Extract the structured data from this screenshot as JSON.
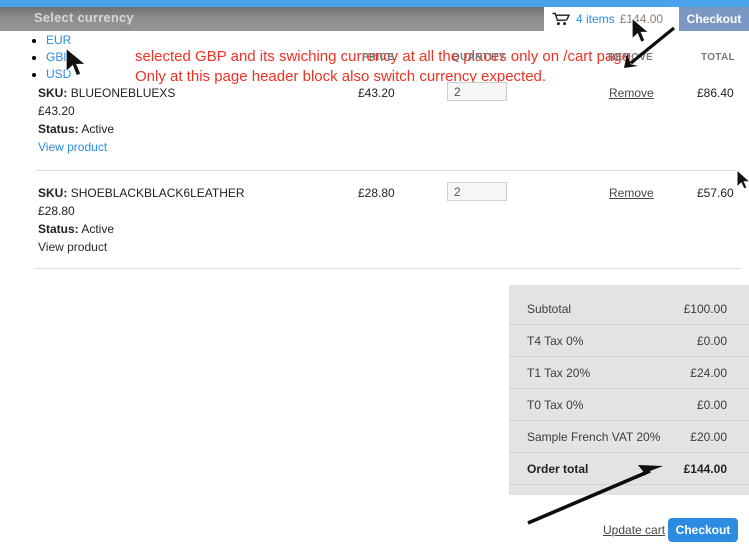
{
  "header": {
    "admin_title": "Select currency",
    "cart_icon": "shopping-cart-icon",
    "cart_items_label": "4 items",
    "cart_total": "£144.00",
    "checkout_label": "Checkout",
    "accent_blue": "#4aa3ea",
    "bar_gray": "#8d8d8d",
    "checkout_button_color": "#7b98c4"
  },
  "currency": {
    "items": [
      {
        "label": "EUR"
      },
      {
        "label": "GBP"
      },
      {
        "label": "USD"
      }
    ]
  },
  "annotation": {
    "text": "selected GBP and its swiching currency at all the places only on /cart page. Only at this page header block also switch currency expected.",
    "color": "#ef3124"
  },
  "table": {
    "headers": {
      "price": "PRICE",
      "quantity": "QUANTITY",
      "remove": "REMOVE",
      "total": "TOTAL"
    },
    "rows": [
      {
        "sku_label": "SKU:",
        "sku_value": "BLUEONEBLUEXS",
        "unit_price": "£43.20",
        "status_label": "Status:",
        "status_value": "Active",
        "view_label": "View product",
        "view_style": "blue",
        "price": "£43.20",
        "quantity": "2",
        "remove_label": "Remove",
        "total": "£86.40"
      },
      {
        "sku_label": "SKU:",
        "sku_value": "SHOEBLACKBLACK6LEATHER",
        "unit_price": "£28.80",
        "status_label": "Status:",
        "status_value": "Active",
        "view_label": "View product",
        "view_style": "dark",
        "price": "£28.80",
        "quantity": "2",
        "remove_label": "Remove",
        "total": "£57.60"
      }
    ]
  },
  "totals": {
    "rows": [
      {
        "label": "Subtotal",
        "value": "£100.00"
      },
      {
        "label": "T4 Tax 0%",
        "value": "£0.00"
      },
      {
        "label": "T1 Tax 20%",
        "value": "£24.00"
      },
      {
        "label": "T0 Tax 0%",
        "value": "£0.00"
      },
      {
        "label": "Sample French VAT 20%",
        "value": "£20.00"
      },
      {
        "label": "Order total",
        "value": "£144.00"
      }
    ]
  },
  "actions": {
    "update_cart_label": "Update cart",
    "checkout_label": "Checkout",
    "checkout_color": "#2b8ce0"
  }
}
